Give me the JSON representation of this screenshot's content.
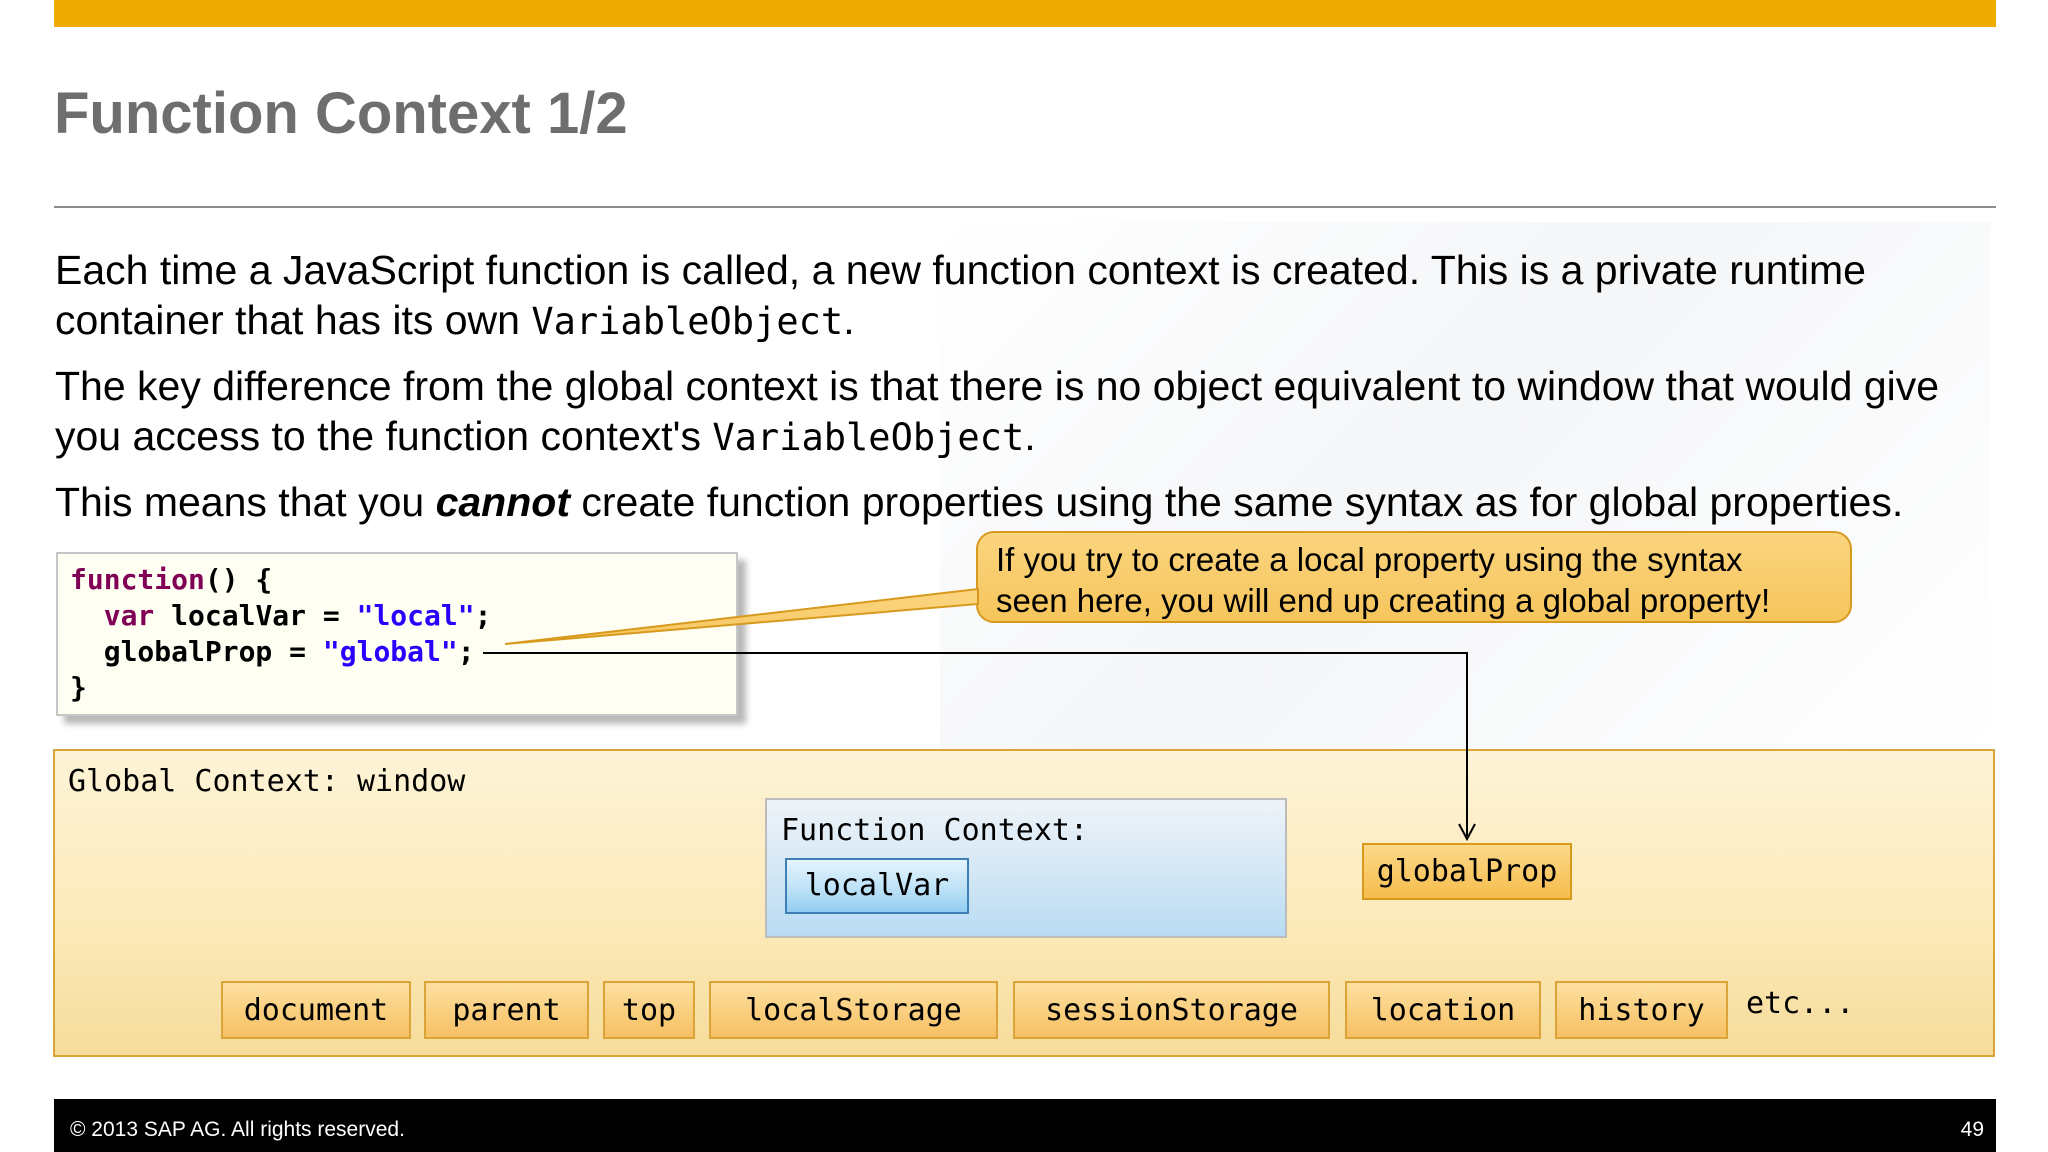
{
  "slide": {
    "title": "Function Context 1/2",
    "para1": {
      "text_a": "Each time a JavaScript function is called, a new function context is created.  This is a private runtime container that has its own ",
      "code": "VariableObject",
      "text_b": "."
    },
    "para2": {
      "text_a": "The key difference from the global context is that there is no object equivalent to window that would give you access to the function context's ",
      "code": "VariableObject",
      "text_b": "."
    },
    "para3": {
      "text_a": "This means that you ",
      "emphasis": "cannot",
      "text_b": " create function properties using the same syntax as for global properties."
    }
  },
  "code": {
    "line1_kw": "function",
    "line1_rest": "() {",
    "line2_kw": "var",
    "line2_mid": " localVar = ",
    "line2_str": "\"local\"",
    "line2_end": ";",
    "line3_mid": "globalProp = ",
    "line3_str": "\"global\"",
    "line3_end": ";",
    "line4": "}"
  },
  "callout": {
    "line1": "If you try to create a local property using the syntax",
    "line2": "seen here, you will end up creating a global property!"
  },
  "diagram": {
    "global_label": "Global Context: window",
    "function_label": "Function Context:",
    "local_var": "localVar",
    "global_prop": "globalProp",
    "props": [
      "document",
      "parent",
      "top",
      "localStorage",
      "sessionStorage",
      "location",
      "history"
    ],
    "etc": "etc..."
  },
  "footer": {
    "copyright": "© 2013 SAP AG. All rights reserved.",
    "page": "49"
  },
  "colors": {
    "accent": "#f0ab00",
    "keyword": "#7f0055",
    "string": "#2a00ff"
  }
}
